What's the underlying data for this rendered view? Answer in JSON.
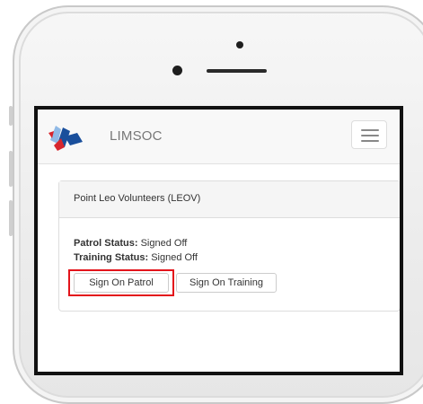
{
  "app": {
    "brand": "LIMSOC"
  },
  "icons": {
    "logo": "limsoc-logo-icon",
    "menu": "hamburger-menu-icon"
  },
  "panel": {
    "heading": "Point Leo Volunteers (LEOV)",
    "patrol_status_label": "Patrol Status:",
    "patrol_status_value": "Signed Off",
    "training_status_label": "Training Status:",
    "training_status_value": "Signed Off"
  },
  "actions": {
    "sign_on_patrol": "Sign On Patrol",
    "sign_on_training": "Sign On Training"
  },
  "colors": {
    "highlight": "#e3141b",
    "logo_blue": "#1a4f9c",
    "logo_red": "#d7262e",
    "logo_light_blue": "#8fb9e6"
  }
}
